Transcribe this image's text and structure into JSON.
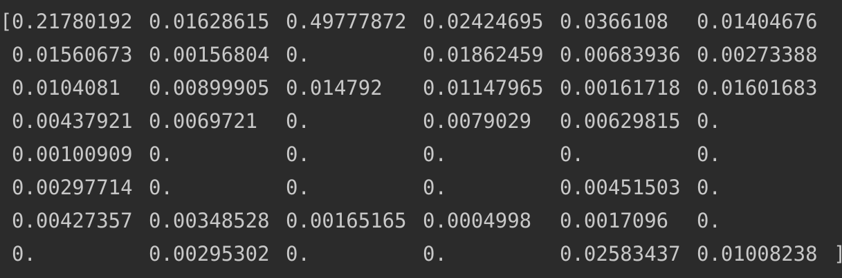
{
  "console": {
    "open_bracket": "[",
    "close_bracket": "]",
    "rows": [
      [
        "0.21780192",
        "0.01628615",
        "0.49777872",
        "0.02424695",
        "0.0366108",
        "0.01404676"
      ],
      [
        "0.01560673",
        "0.00156804",
        "0.",
        "0.01862459",
        "0.00683936",
        "0.00273388"
      ],
      [
        "0.0104081",
        "0.00899905",
        "0.014792",
        "0.01147965",
        "0.00161718",
        "0.01601683"
      ],
      [
        "0.00437921",
        "0.0069721",
        "0.",
        "0.0079029",
        "0.00629815",
        "0."
      ],
      [
        "0.00100909",
        "0.",
        "0.",
        "0.",
        "0.",
        "0."
      ],
      [
        "0.00297714",
        "0.",
        "0.",
        "0.",
        "0.00451503",
        "0."
      ],
      [
        "0.00427357",
        "0.00348528",
        "0.00165165",
        "0.0004998",
        "0.0017096",
        "0."
      ],
      [
        "0.",
        "0.00295302",
        "0.",
        "0.",
        "0.02583437",
        "0.01008238"
      ]
    ]
  }
}
